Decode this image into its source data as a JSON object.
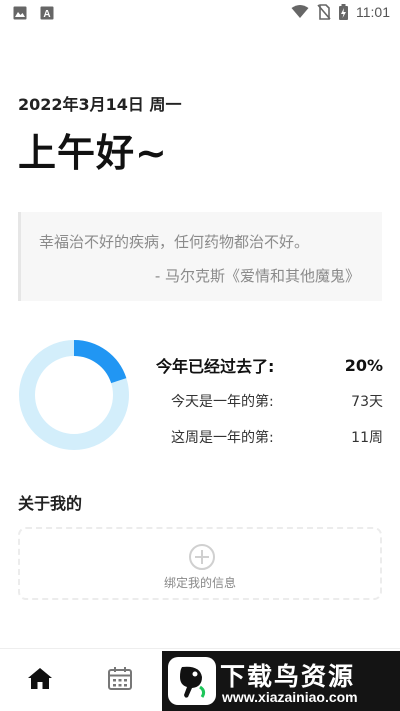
{
  "status_bar": {
    "time": "11:01",
    "left_icons": [
      "image-icon",
      "text-icon"
    ],
    "right_icons": [
      "wifi-icon",
      "no-sim-icon",
      "battery-charging-icon"
    ]
  },
  "header": {
    "date": "2022年3月14日 周一",
    "greeting": "上午好~"
  },
  "quote": {
    "text": "幸福治不好的疾病，任何药物都治不好。",
    "source": "- 马尔克斯《爱情和其他魔鬼》"
  },
  "year_progress": {
    "progress_fraction": 0.2,
    "ring_color": "#2196f3",
    "track_color": "#d3eefb",
    "rows": [
      {
        "label": "今年已经过去了:",
        "value": "20%"
      },
      {
        "label": "今天是一年的第:",
        "value": "73天"
      },
      {
        "label": "这周是一年的第:",
        "value": "11周"
      }
    ]
  },
  "about": {
    "title": "关于我的",
    "bind_label": "绑定我的信息"
  },
  "bottom_nav": {
    "items": [
      "home-icon",
      "calendar-icon"
    ]
  },
  "watermark": {
    "title": "下载鸟资源",
    "url": "www.xiazainiao.com"
  }
}
